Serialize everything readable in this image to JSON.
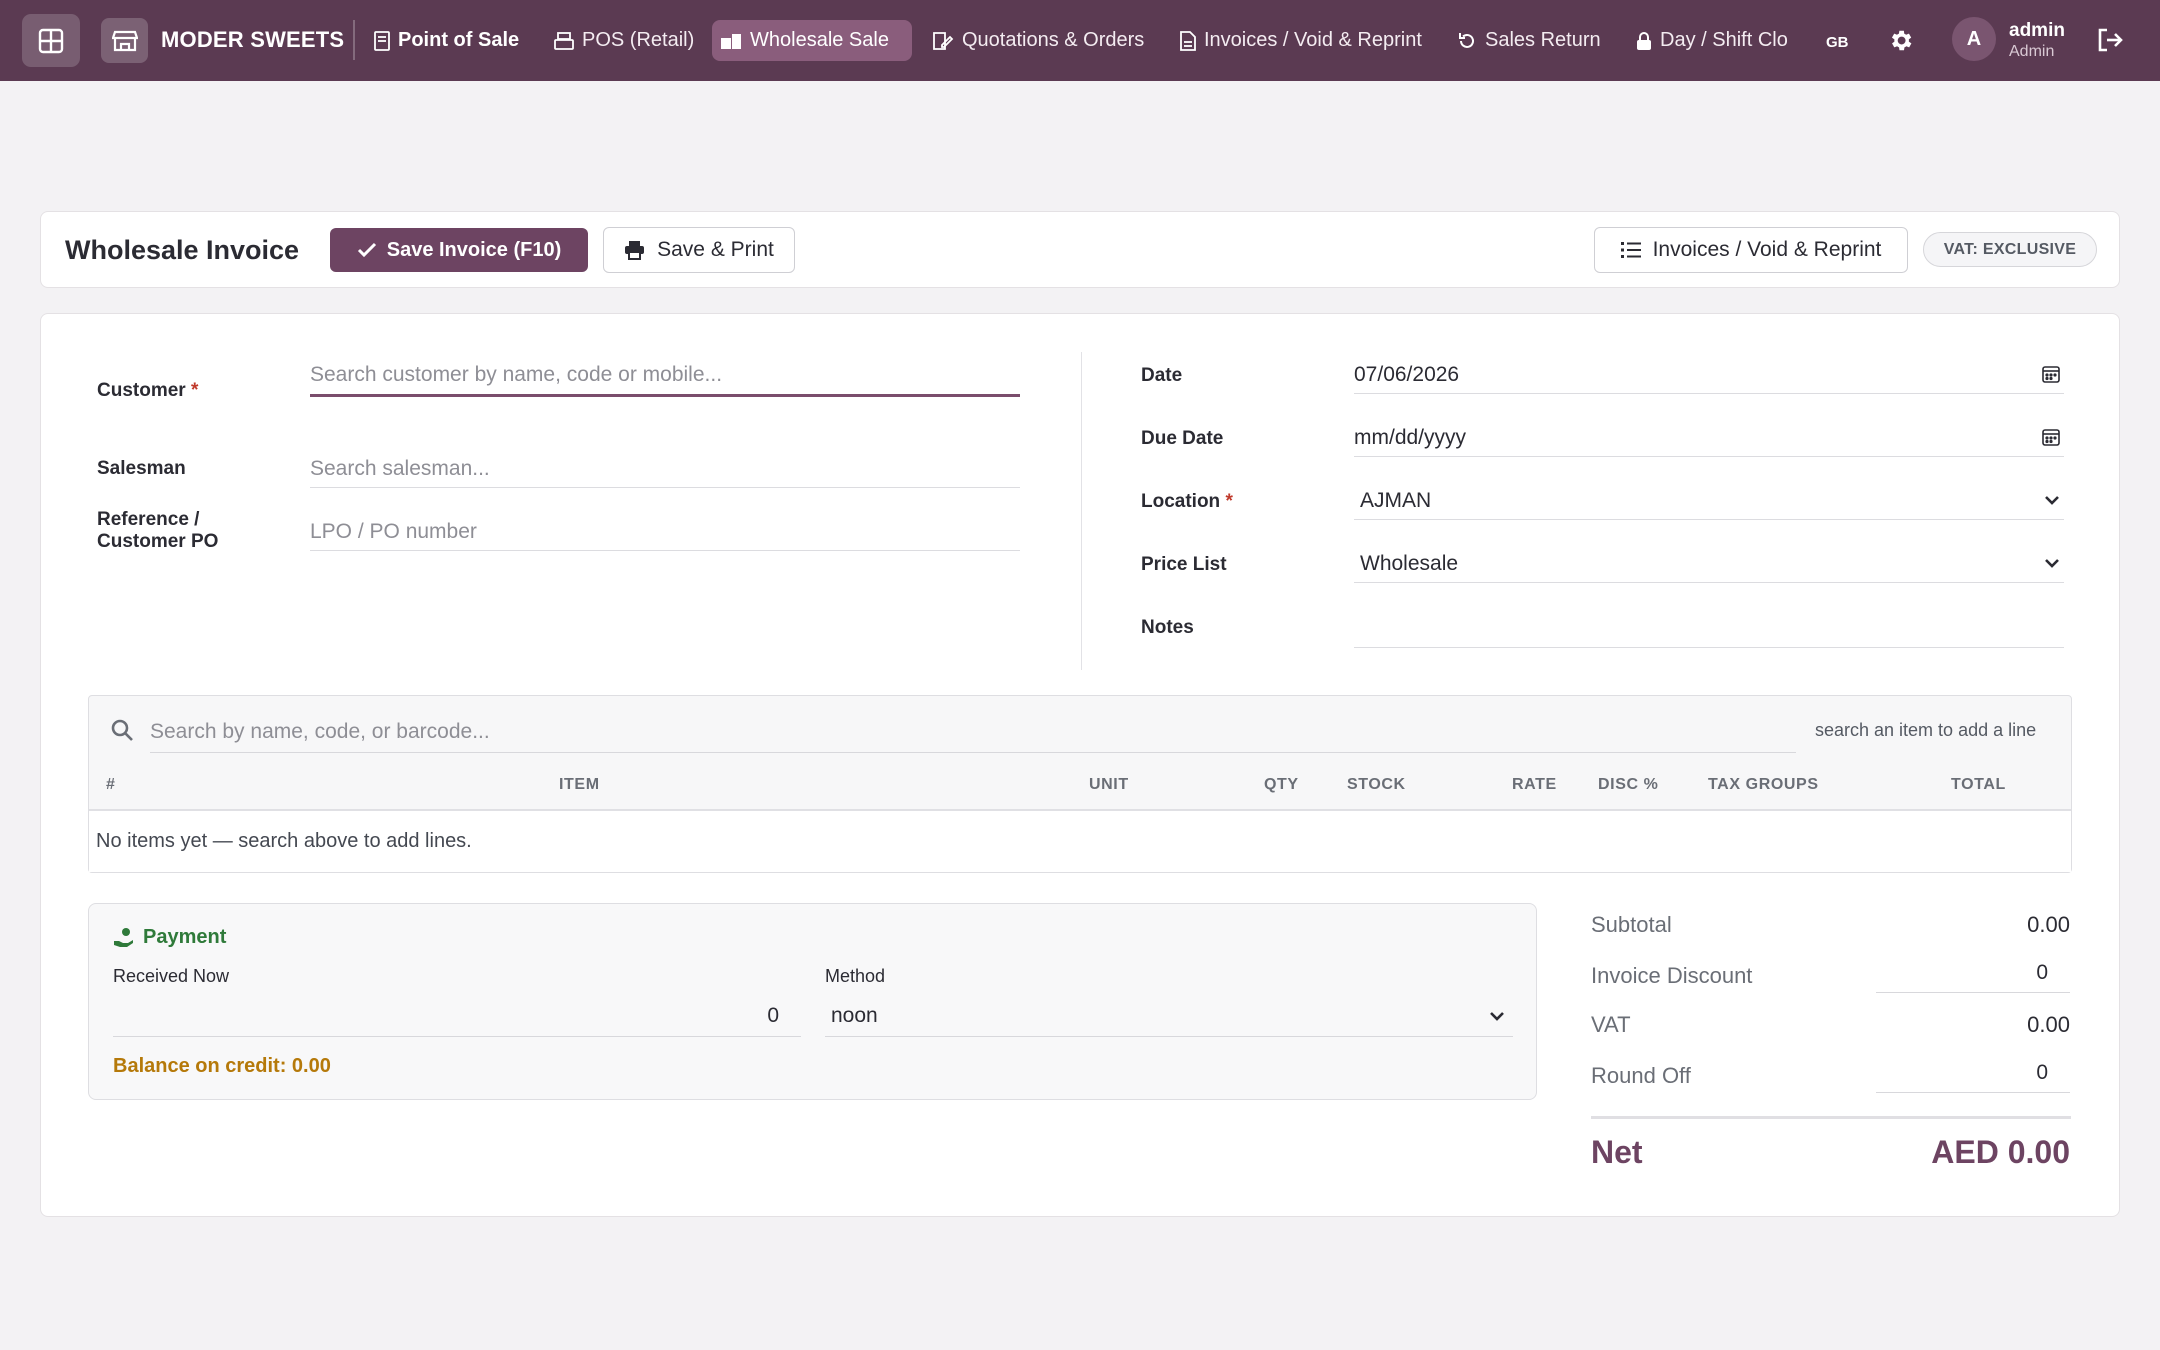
{
  "brand": {
    "name": "MODER SWEETS"
  },
  "nav": {
    "items": [
      {
        "label": "Point of Sale"
      },
      {
        "label": "POS (Retail)"
      },
      {
        "label": "Wholesale Sale"
      },
      {
        "label": "Quotations & Orders"
      },
      {
        "label": "Invoices / Void & Reprint"
      },
      {
        "label": "Sales Return"
      },
      {
        "label": "Day / Shift Clo"
      }
    ],
    "active_index": 2,
    "lang": "GB",
    "user": {
      "initial": "A",
      "name": "admin",
      "role": "Admin"
    }
  },
  "header": {
    "title": "Wholesale Invoice",
    "save_label": "Save Invoice (F10)",
    "save_print_label": "Save & Print",
    "invoices_label": "Invoices / Void & Reprint",
    "vat_badge": "VAT: EXCLUSIVE"
  },
  "form": {
    "customer": {
      "label": "Customer",
      "required": "*",
      "placeholder": "Search customer by name, code or mobile..."
    },
    "salesman": {
      "label": "Salesman",
      "placeholder": "Search salesman..."
    },
    "reference": {
      "label_line1": "Reference /",
      "label_line2": "Customer PO",
      "placeholder": "LPO / PO number"
    },
    "date": {
      "label": "Date",
      "value": "07/06/2026"
    },
    "due_date": {
      "label": "Due Date",
      "placeholder": "mm/dd/yyyy"
    },
    "location": {
      "label": "Location",
      "required": "*",
      "value": "AJMAN"
    },
    "price_list": {
      "label": "Price List",
      "value": "Wholesale"
    },
    "notes": {
      "label": "Notes",
      "value": ""
    }
  },
  "items": {
    "search_placeholder": "Search by name, code, or barcode...",
    "hint": "search an item to add a line",
    "columns": [
      "#",
      "ITEM",
      "UNIT",
      "QTY",
      "STOCK",
      "RATE",
      "DISC %",
      "TAX GROUPS",
      "TOTAL"
    ],
    "empty_text": "No items yet — search above to add lines."
  },
  "payment": {
    "title": "Payment",
    "received_label": "Received Now",
    "received_value": "0",
    "method_label": "Method",
    "method_value": "noon",
    "balance": "Balance on credit: 0.00"
  },
  "totals": {
    "subtotal_label": "Subtotal",
    "subtotal": "0.00",
    "discount_label": "Invoice Discount",
    "discount": "0",
    "vat_label": "VAT",
    "vat": "0.00",
    "roundoff_label": "Round Off",
    "roundoff": "0",
    "net_label": "Net",
    "net": "AED 0.00"
  },
  "colors": {
    "brand": "#5b3a52",
    "primary_button": "#6d4462",
    "payment_title": "#2f7a3a",
    "balance": "#b5790a"
  }
}
